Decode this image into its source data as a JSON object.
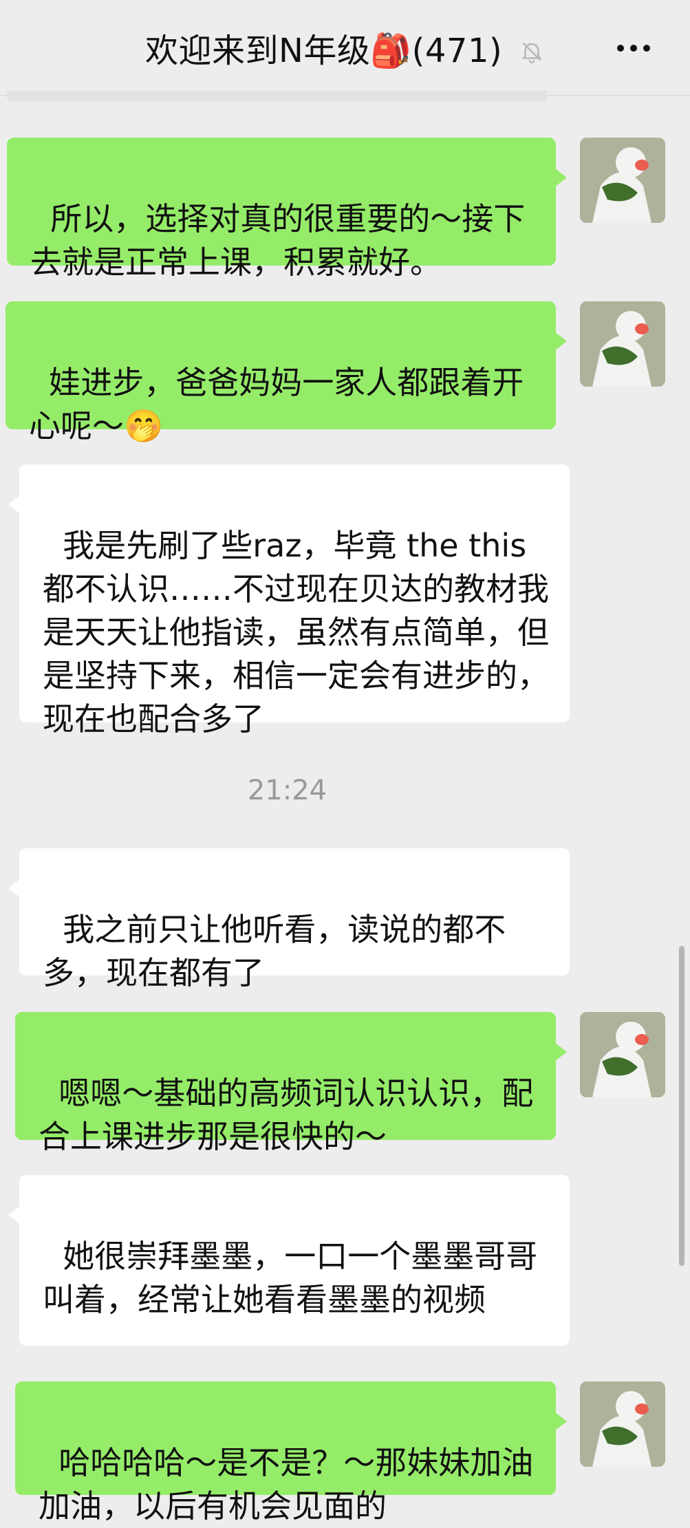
{
  "header": {
    "title": "欢迎来到N年级🎒(471)",
    "icons": [
      "mute-bell-icon",
      "more-icon"
    ]
  },
  "messages": [
    {
      "side": "right",
      "text": "所以，选择对真的很重要的～接下去就是正常上课，积累就好。"
    },
    {
      "side": "right",
      "text": "娃进步，爸爸妈妈一家人都跟着开心呢～🤭"
    },
    {
      "side": "left",
      "text": "我是先刷了些raz，毕竟 the this都不认识……不过现在贝达的教材我是天天让他指读，虽然有点简单，但是坚持下来，相信一定会有进步的，现在也配合多了"
    },
    {
      "side": "center",
      "text": "21:24"
    },
    {
      "side": "left",
      "text": "我之前只让他听看，读说的都不多，现在都有了"
    },
    {
      "side": "right",
      "text": "嗯嗯～基础的高频词认识认识，配合上课进步那是很快的～"
    },
    {
      "side": "left",
      "text": "她很崇拜墨墨，一口一个墨墨哥哥叫着，经常让她看看墨墨的视频"
    },
    {
      "side": "right",
      "text": "哈哈哈哈～是不是？～那妹妹加油加油，以后有机会见面的"
    }
  ]
}
